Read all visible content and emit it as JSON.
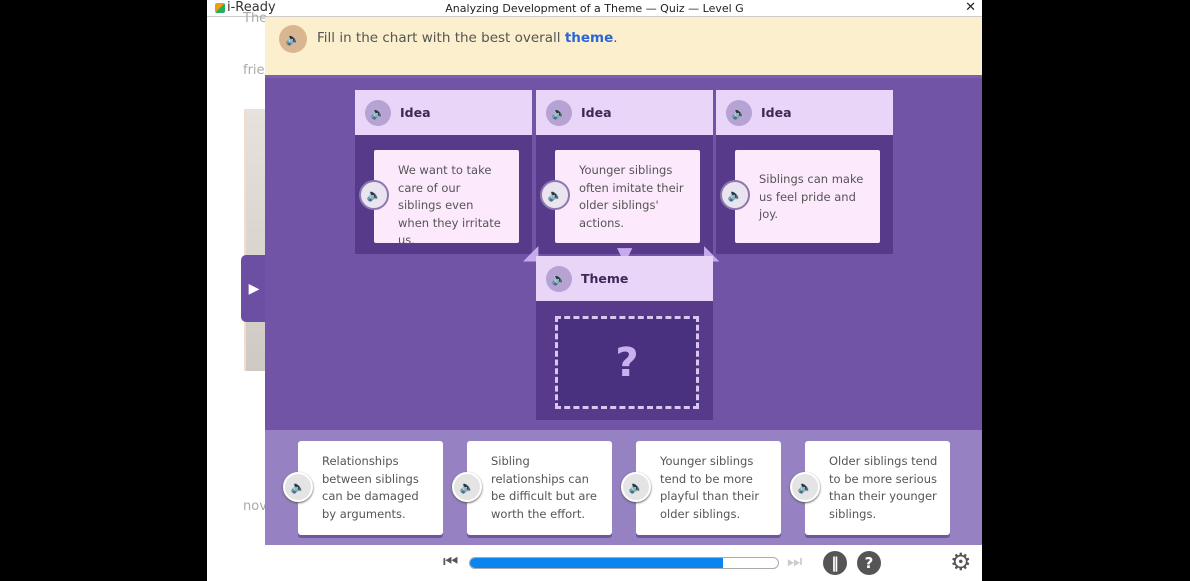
{
  "window": {
    "app_name": "i-Ready",
    "title": "Analyzing Development of a Theme — Quiz — Level G",
    "close": "✕"
  },
  "reader": {
    "ghost_text": [
      "The",
      "frie",
      "nov"
    ]
  },
  "instruction": {
    "text": "Fill in the chart with the best overall ",
    "highlight": "theme",
    "end": "."
  },
  "ideas": [
    {
      "label": "Idea",
      "text": "We want to take care of our siblings even when they irritate us."
    },
    {
      "label": "Idea",
      "text": "Younger siblings often imitate their older siblings' actions."
    },
    {
      "label": "Idea",
      "text": "Siblings can make us feel pride and joy."
    }
  ],
  "theme": {
    "label": "Theme",
    "placeholder": "?"
  },
  "answers": [
    "Relationships between siblings can be damaged by arguments.",
    "Sibling relationships can be difficult but are worth the effort.",
    "Younger siblings tend to be more playful than their older siblings.",
    "Older siblings tend to be more serious than their younger siblings."
  ],
  "footer": {
    "progress_percent": 82
  },
  "colors": {
    "purple": "#7254a6",
    "banner": "#fcefcd",
    "progress": "#0a84ee",
    "link": "#2a66d8"
  }
}
